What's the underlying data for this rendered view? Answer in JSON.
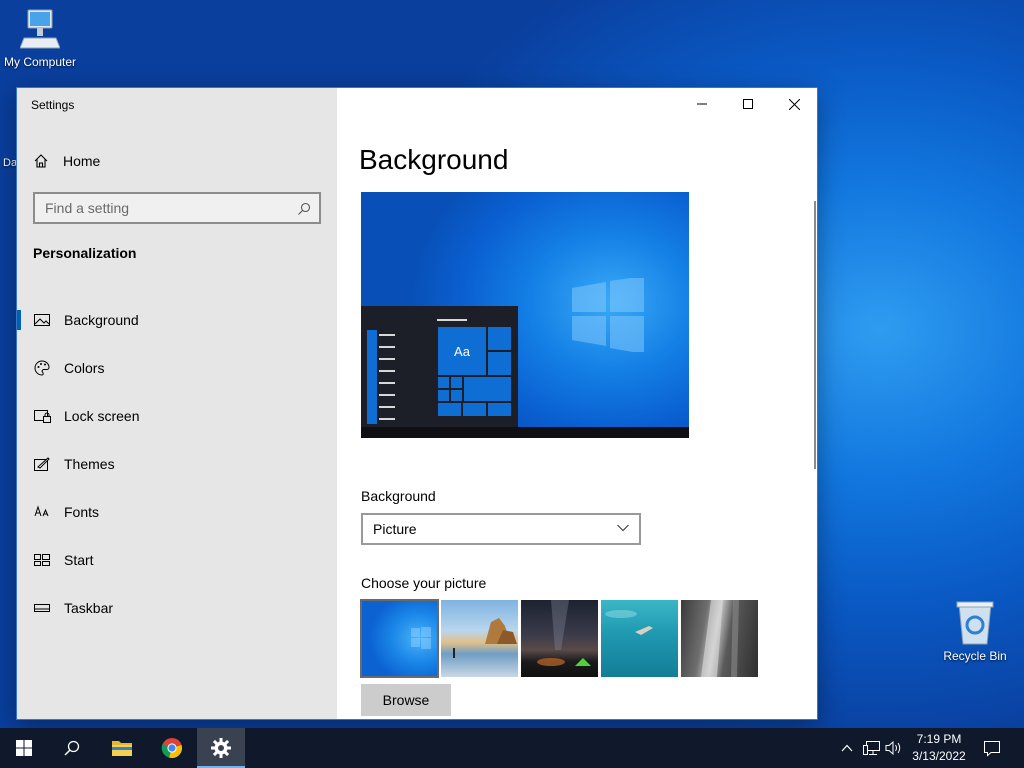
{
  "desktop": {
    "my_computer_label": "My Computer",
    "recycle_bin_label": "Recycle Bin",
    "partial_icon_label": "Da"
  },
  "window": {
    "title": "Settings",
    "minimize_icon": "minimize-icon",
    "maximize_icon": "maximize-icon",
    "close_icon": "close-icon"
  },
  "sidebar": {
    "home_label": "Home",
    "search_placeholder": "Find a setting",
    "section_title": "Personalization",
    "items": [
      {
        "label": "Background",
        "icon": "picture-icon",
        "active": true
      },
      {
        "label": "Colors",
        "icon": "palette-icon",
        "active": false
      },
      {
        "label": "Lock screen",
        "icon": "lock-screen-icon",
        "active": false
      },
      {
        "label": "Themes",
        "icon": "themes-icon",
        "active": false
      },
      {
        "label": "Fonts",
        "icon": "fonts-icon",
        "active": false
      },
      {
        "label": "Start",
        "icon": "start-icon",
        "active": false
      },
      {
        "label": "Taskbar",
        "icon": "taskbar-icon",
        "active": false
      }
    ]
  },
  "main": {
    "page_title": "Background",
    "preview_tile_text": "Aa",
    "background_label": "Background",
    "background_value": "Picture",
    "choose_picture_label": "Choose your picture",
    "browse_label": "Browse"
  },
  "taskbar": {
    "time": "7:19 PM",
    "date": "3/13/2022",
    "apps": [
      "start-icon",
      "search-icon",
      "file-explorer-icon",
      "chrome-icon",
      "settings-icon"
    ],
    "active_app": "settings-icon"
  },
  "colors": {
    "accent": "#0063b1",
    "sidebar_bg": "#e6e6e6",
    "taskbar_bg": "#10182b"
  }
}
